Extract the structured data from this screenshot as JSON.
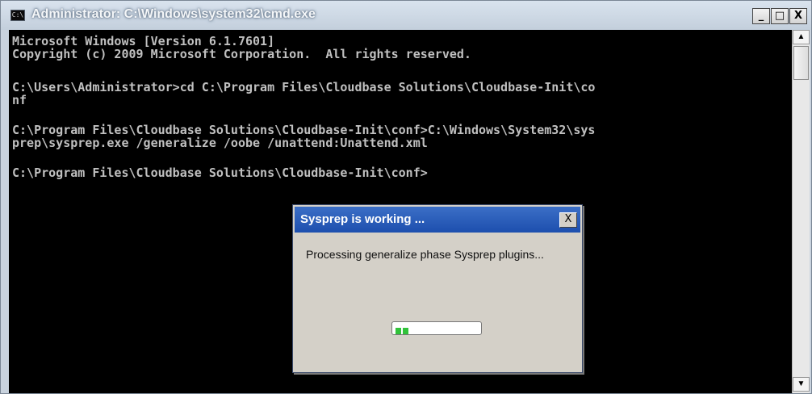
{
  "window": {
    "title": "Administrator: C:\\Windows\\system32\\cmd.exe",
    "icon": "cmd-app-icon",
    "icon_text": "C:\\",
    "controls": {
      "minimize": "_",
      "maximize": "□",
      "close": "X"
    }
  },
  "console": {
    "lines": [
      "Microsoft Windows [Version 6.1.7601]",
      "Copyright (c) 2009 Microsoft Corporation.  All rights reserved.",
      "",
      "C:\\Users\\Administrator>cd C:\\Program Files\\Cloudbase Solutions\\Cloudbase-Init\\co",
      "nf",
      "",
      "C:\\Program Files\\Cloudbase Solutions\\Cloudbase-Init\\conf>C:\\Windows\\System32\\sys",
      "prep\\sysprep.exe /generalize /oobe /unattend:Unattend.xml",
      "",
      "C:\\Program Files\\Cloudbase Solutions\\Cloudbase-Init\\conf>"
    ]
  },
  "scrollbar": {
    "up": "▲",
    "down": "▼"
  },
  "dialog": {
    "title": "Sysprep is working ...",
    "close": "X",
    "message": "Processing generalize phase Sysprep plugins...",
    "progress": {
      "mode": "marquee",
      "color": "#31c23a"
    }
  }
}
